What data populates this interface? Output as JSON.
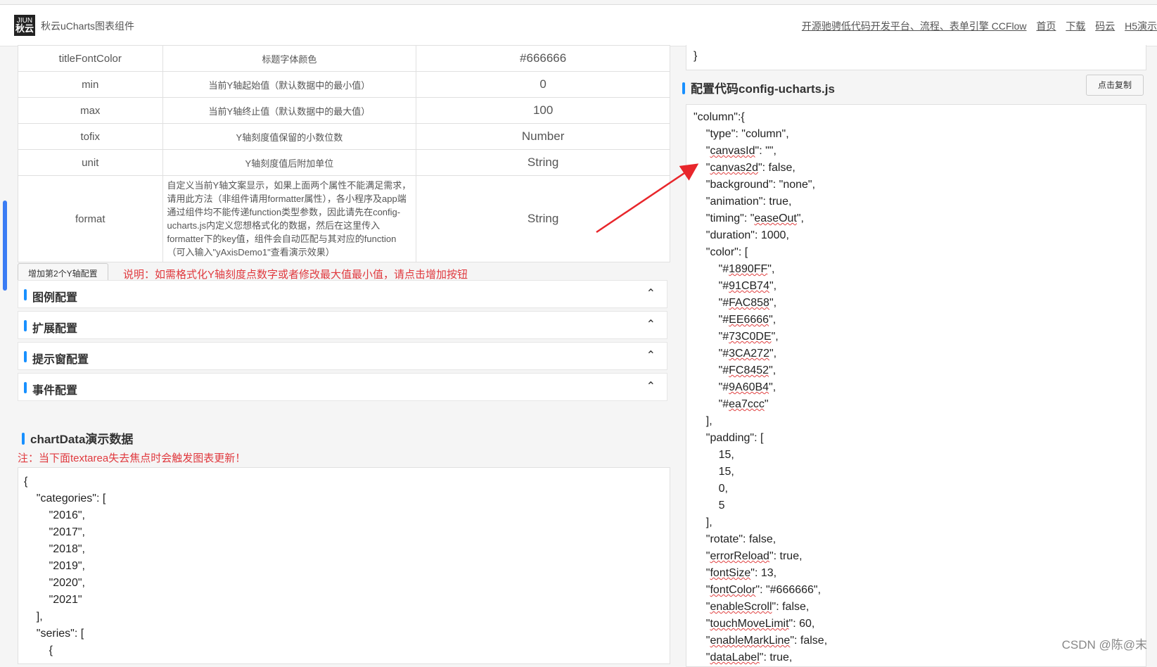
{
  "header": {
    "logo_top": "JIUN",
    "logo_bottom": "秋云",
    "title": "秋云uCharts图表组件",
    "nav": [
      "开源驰骋低代码开发平台、流程、表单引擎 CCFlow",
      "首页",
      "下载",
      "码云",
      "H5演示"
    ]
  },
  "table": {
    "rows": [
      {
        "name": "titleFontColor",
        "desc": "标题字体颜色",
        "value": "#666666"
      },
      {
        "name": "min",
        "desc": "当前Y轴起始值（默认数据中的最小值）",
        "value": "0"
      },
      {
        "name": "max",
        "desc": "当前Y轴终止值（默认数据中的最大值）",
        "value": "100"
      },
      {
        "name": "tofix",
        "desc": "Y轴刻度值保留的小数位数",
        "value": "Number"
      },
      {
        "name": "unit",
        "desc": "Y轴刻度值后附加单位",
        "value": "String"
      }
    ],
    "format_row": {
      "name": "format",
      "desc": "自定义当前Y轴文案显示，如果上面两个属性不能满足需求，请用此方法（非组件请用formatter属性），各小程序及app端通过组件均不能传递function类型参数，因此请先在config-ucharts.js内定义您想格式化的数据，然后在这里传入formatter下的key值，组件会自动匹配与其对应的function（可入输入\"yAxisDemo1\"查看演示效果）",
      "value": "String"
    }
  },
  "add_button": "增加第2个Y轴配置",
  "add_note": "说明：如需格式化Y轴刻度点数字或者修改最大值最小值，请点击增加按钮",
  "sections": [
    "图例配置",
    "扩展配置",
    "提示窗配置",
    "事件配置"
  ],
  "chartdata": {
    "heading": "chartData演示数据",
    "note": "注：当下面textarea失去焦点时会触发图表更新！",
    "code": "{\n    \"categories\": [\n        \"2016\",\n        \"2017\",\n        \"2018\",\n        \"2019\",\n        \"2020\",\n        \"2021\"\n    ],\n    \"series\": [\n        {"
  },
  "right_top_code": "}",
  "config": {
    "heading": "配置代码config-ucharts.js",
    "copy_button": "点击复制"
  },
  "watermark": "CSDN @陈@末"
}
